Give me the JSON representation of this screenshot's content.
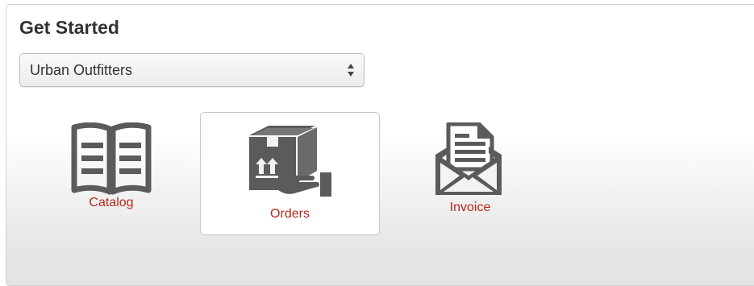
{
  "panel": {
    "title": "Get Started"
  },
  "account_select": {
    "selected": "Urban Outfitters"
  },
  "tiles": [
    {
      "label": "Catalog",
      "icon": "book-icon",
      "selected": false
    },
    {
      "label": "Orders",
      "icon": "package-delivery-icon",
      "selected": true
    },
    {
      "label": "Invoice",
      "icon": "envelope-document-icon",
      "selected": false
    }
  ],
  "colors": {
    "label": "#b5281c",
    "icon": "#5b5b5b",
    "title": "#333333"
  }
}
